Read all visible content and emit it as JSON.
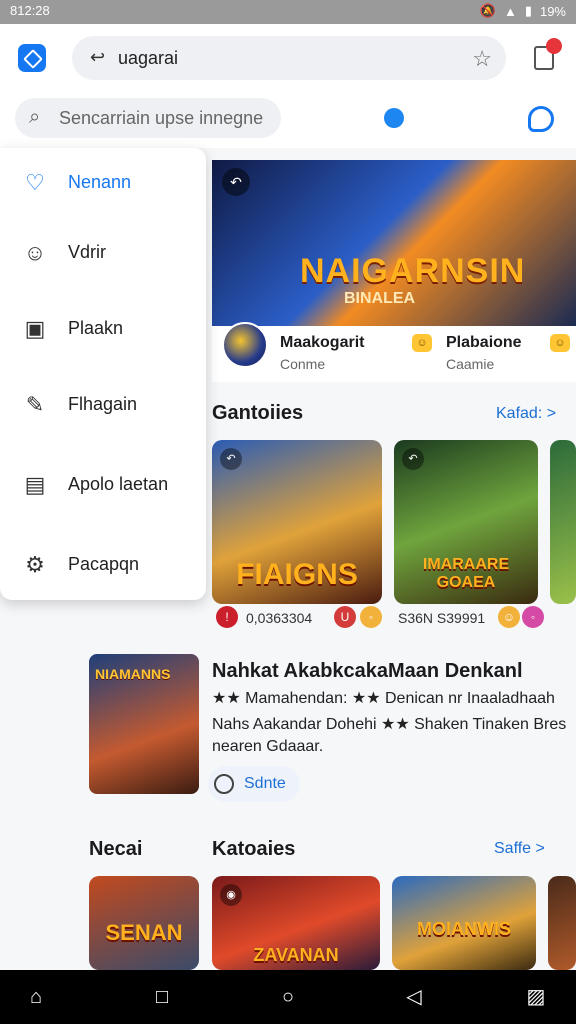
{
  "status": {
    "time": "812:28",
    "battery": "19%",
    "icons": [
      "mute-icon",
      "wifi-icon",
      "signal-icon",
      "battery-icon"
    ]
  },
  "browser": {
    "url_text": "uagarai",
    "search_placeholder": "Sencarriain upse innegne"
  },
  "drawer": {
    "items": [
      {
        "label": "Nenann",
        "icon": "home-heart-icon",
        "glyph": "♡"
      },
      {
        "label": "Vdrir",
        "icon": "chat-icon",
        "glyph": "☺"
      },
      {
        "label": "Plaakn",
        "icon": "card-icon",
        "glyph": "▣"
      },
      {
        "label": "Flhagain",
        "icon": "pen-icon",
        "glyph": "✎"
      },
      {
        "label": "Apolo laetan",
        "icon": "wallet-icon",
        "glyph": "▤"
      },
      {
        "label": "Pacapqn",
        "icon": "gear-icon",
        "glyph": "⚙"
      }
    ]
  },
  "hero": {
    "title": "NAIGARNSIN",
    "subtitle": "BINALEA",
    "app1_name": "Maakogarit",
    "app1_sub": "Conme",
    "app2_name": "Plabaione",
    "app2_sub": "Caamie"
  },
  "section1": {
    "title": "Gantoiies",
    "see_more": "Kafad: >",
    "cards": [
      {
        "caption": "FIAIGNS",
        "price": "0,0363304"
      },
      {
        "caption": "IMARAARE GOAEA",
        "price": "S36N S39991"
      }
    ]
  },
  "feature": {
    "image_caption": "NIAMANNS",
    "title": "Nahkat AkabkcakaMaan Denkanl",
    "line1": "★★ Mamahendan: ★★ Denican nr Inaaladhaah",
    "line2": "Nahs Aakandar Dohehi ★★ Shaken Tinaken Bres",
    "line3": "nearen Gdaaar.",
    "chip_label": "Sdnte"
  },
  "section2": {
    "left_title": "Necai",
    "title": "Katoaies",
    "see_more": "Saffe >",
    "cards": [
      {
        "caption": "SENAN"
      },
      {
        "caption": "ZAVANAN"
      },
      {
        "caption": "MOIANWIS"
      }
    ]
  },
  "navbar": [
    "home-icon",
    "square-icon",
    "circle-icon",
    "back-icon",
    "screenshot-icon"
  ]
}
